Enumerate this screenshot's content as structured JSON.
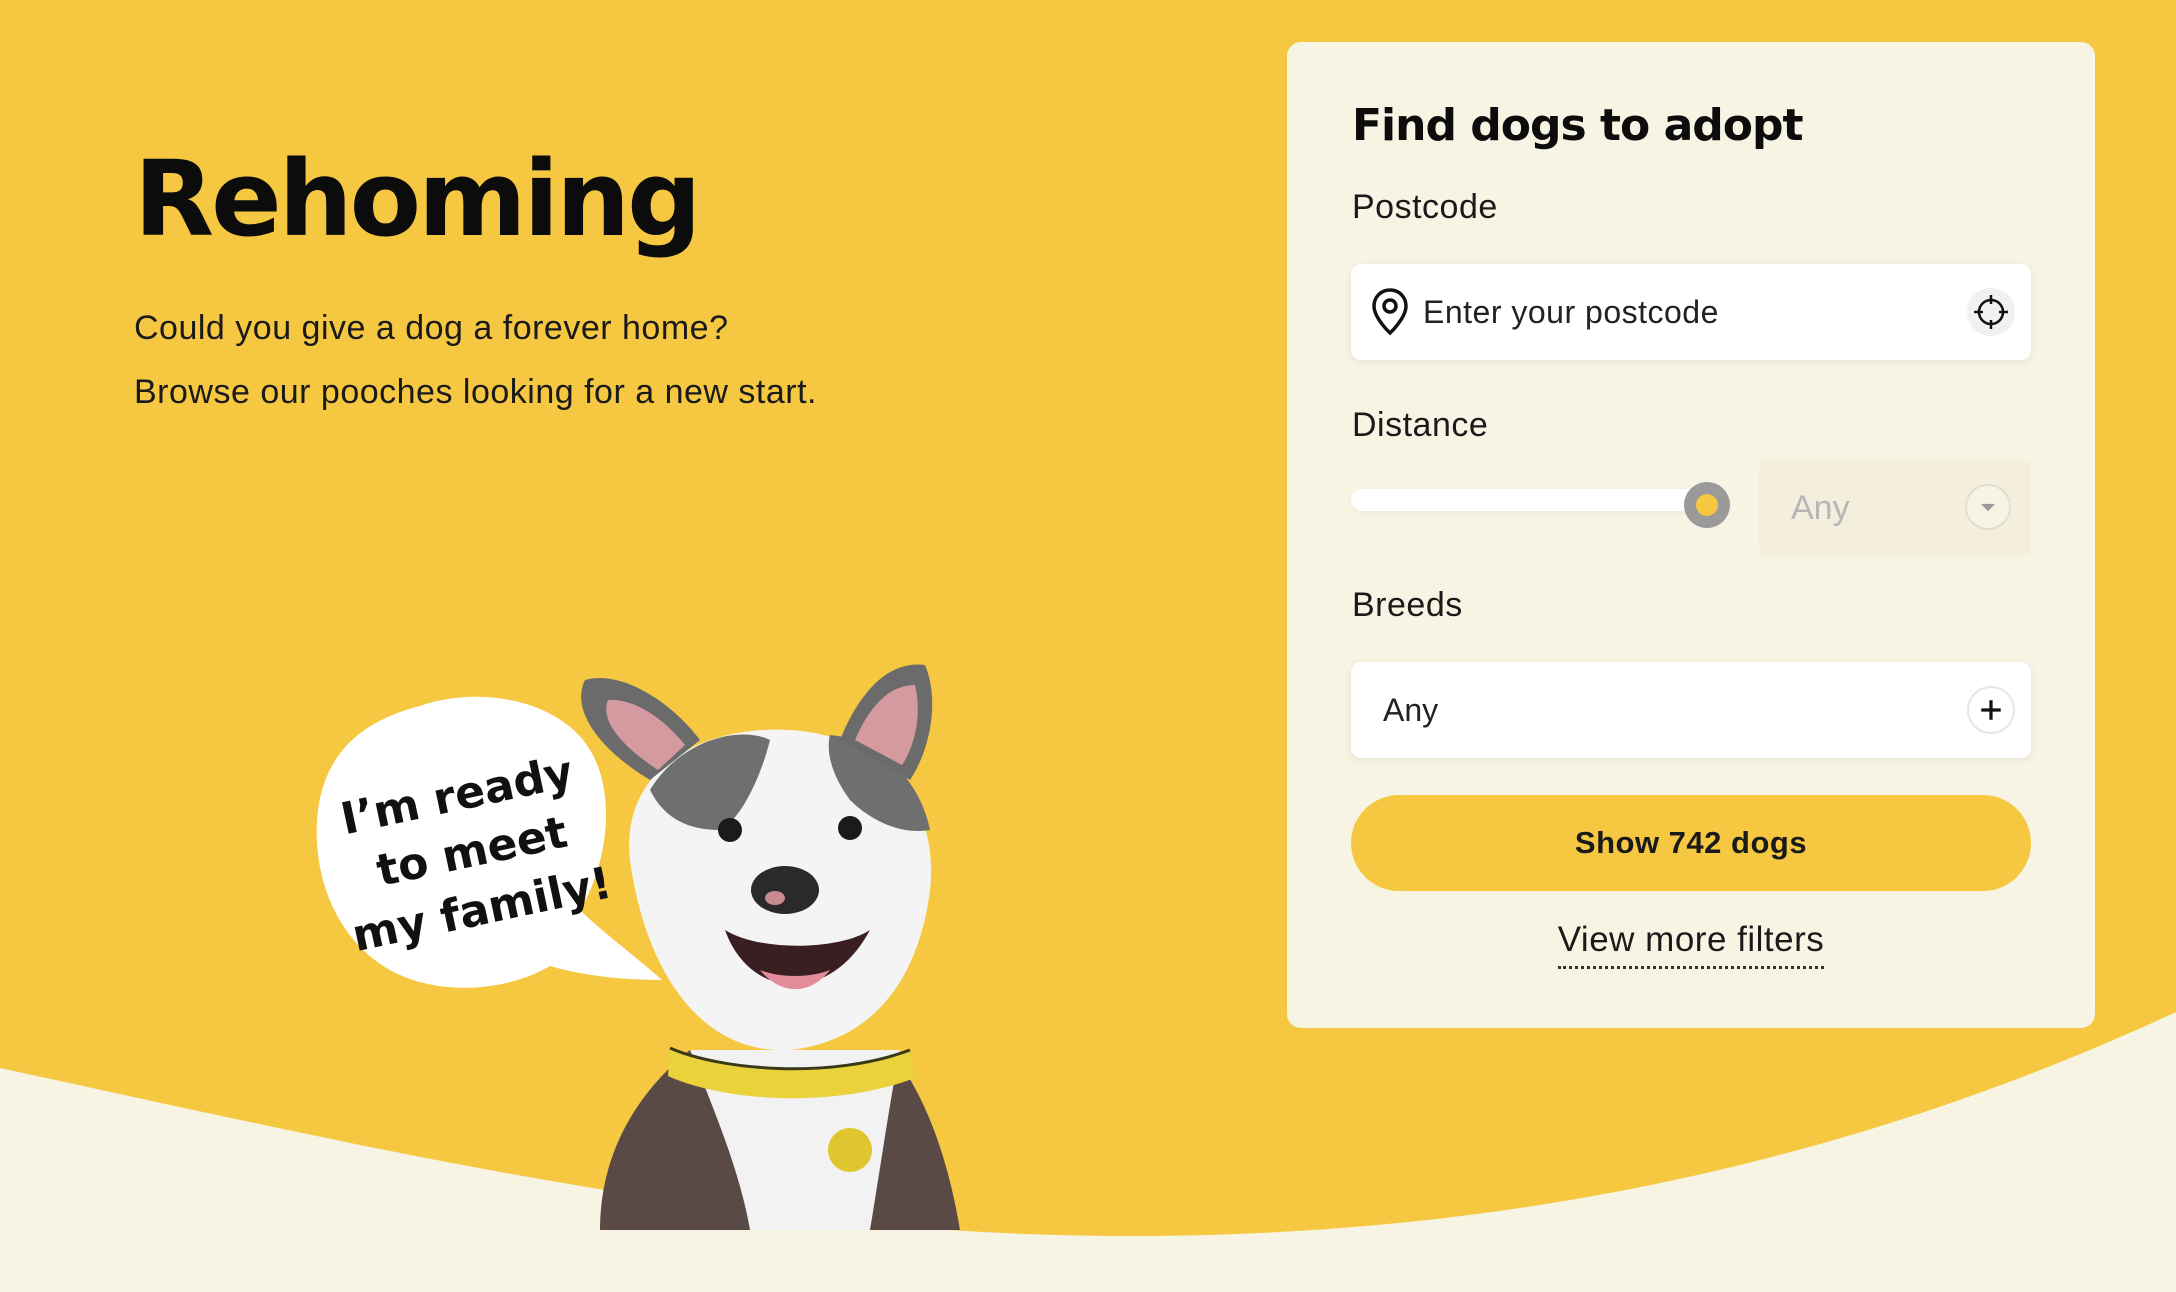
{
  "hero": {
    "title": "Rehoming",
    "description": "Could you give a dog a forever home? Browse our pooches looking for a new start."
  },
  "illustration": {
    "speech_line_1": "I’m ready",
    "speech_line_2": "to meet",
    "speech_line_3": "my family!"
  },
  "search_panel": {
    "title": "Find dogs to adopt",
    "postcode": {
      "label": "Postcode",
      "placeholder": "Enter your postcode",
      "value": "",
      "icon": "location-pin-icon",
      "locate_icon": "crosshair-icon"
    },
    "distance": {
      "label": "Distance",
      "slider_level": 1.0,
      "select_value": "Any",
      "chevron_icon": "chevron-down-icon"
    },
    "breeds": {
      "label": "Breeds",
      "value": "Any",
      "add_icon": "plus-icon"
    },
    "submit_label": "Show 742 dogs",
    "more_filters_label": "View more filters"
  },
  "colors": {
    "brand_yellow": "#F6C842",
    "panel_background": "#F8F4E4",
    "page_cream": "#F8F4E4"
  }
}
